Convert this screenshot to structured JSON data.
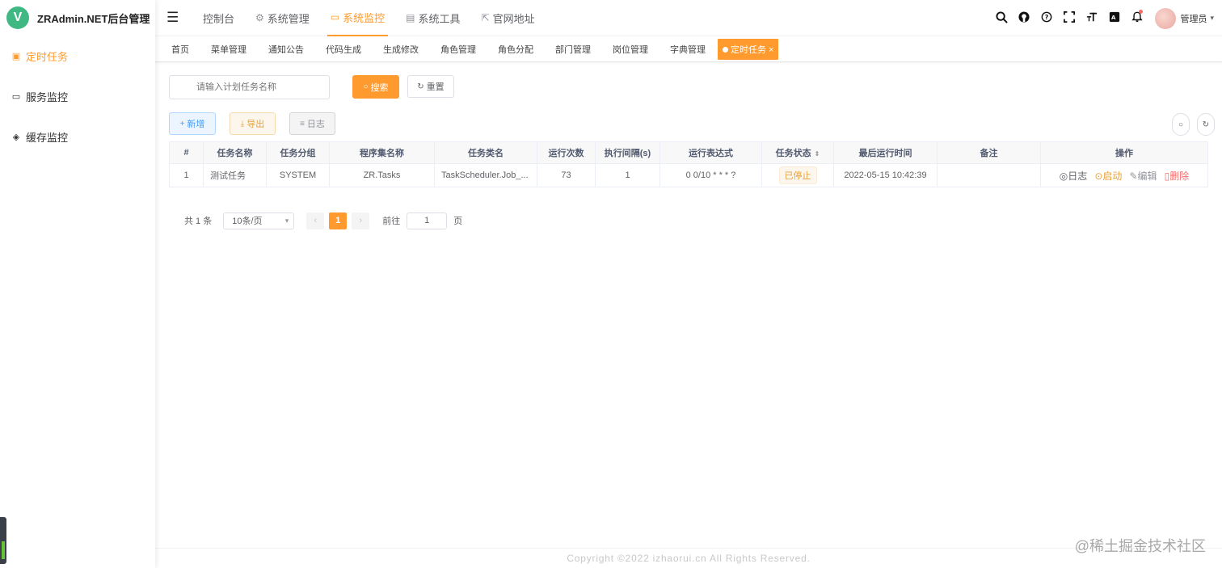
{
  "app": {
    "logo_letter": "V",
    "title": "ZRAdmin.NET后台管理"
  },
  "sidebar": {
    "items": [
      {
        "label": "定时任务",
        "icon": "job-icon",
        "active": true
      },
      {
        "label": "服务监控",
        "icon": "monitor-icon",
        "active": false
      },
      {
        "label": "缓存监控",
        "icon": "cache-icon",
        "active": false
      }
    ]
  },
  "topnav": {
    "items": [
      {
        "label": "控制台",
        "icon": ""
      },
      {
        "label": "系统管理",
        "icon": "gear-icon"
      },
      {
        "label": "系统监控",
        "icon": "monitor-icon"
      },
      {
        "label": "系统工具",
        "icon": "toolbox-icon"
      },
      {
        "label": "官网地址",
        "icon": "external-link-icon"
      }
    ],
    "active": "系统监控"
  },
  "user": {
    "name": "管理员"
  },
  "tags": [
    "首页",
    "菜单管理",
    "通知公告",
    "代码生成",
    "生成修改",
    "角色管理",
    "角色分配",
    "部门管理",
    "岗位管理",
    "字典管理"
  ],
  "active_tag": "定时任务",
  "search": {
    "placeholder": "请输入计划任务名称",
    "search_label": "搜索",
    "reset_label": "重置"
  },
  "toolbar": {
    "add_label": "新增",
    "export_label": "导出",
    "log_label": "日志"
  },
  "table": {
    "columns": [
      "#",
      "任务名称",
      "任务分组",
      "程序集名称",
      "任务类名",
      "运行次数",
      "执行间隔(s)",
      "运行表达式",
      "任务状态",
      "最后运行时间",
      "备注",
      "操作"
    ],
    "rows": [
      {
        "index": "1",
        "name": "测试任务",
        "group": "SYSTEM",
        "assembly": "ZR.Tasks",
        "class_name": "TaskScheduler.Job_...",
        "run_count": "73",
        "interval": "1",
        "cron": "0 0/10 * * * ?",
        "status": "已停止",
        "last_run": "2022-05-15 10:42:39",
        "remark": "",
        "actions": {
          "log": "日志",
          "start": "启动",
          "edit": "编辑",
          "delete": "删除"
        }
      }
    ]
  },
  "pager": {
    "total_text": "共 1 条",
    "page_size": "10条/页",
    "current_page": "1",
    "goto_label": "前往",
    "goto_value": "1",
    "page_unit": "页"
  },
  "footer": {
    "copyright": "Copyright ©2022 izhaorui.cn All Rights Reserved."
  },
  "watermark": "@稀土掘金技术社区",
  "colors": {
    "accent": "#ff9a2e",
    "brand": "#3fb884",
    "danger": "#f56c6c",
    "info": "#409eff"
  }
}
